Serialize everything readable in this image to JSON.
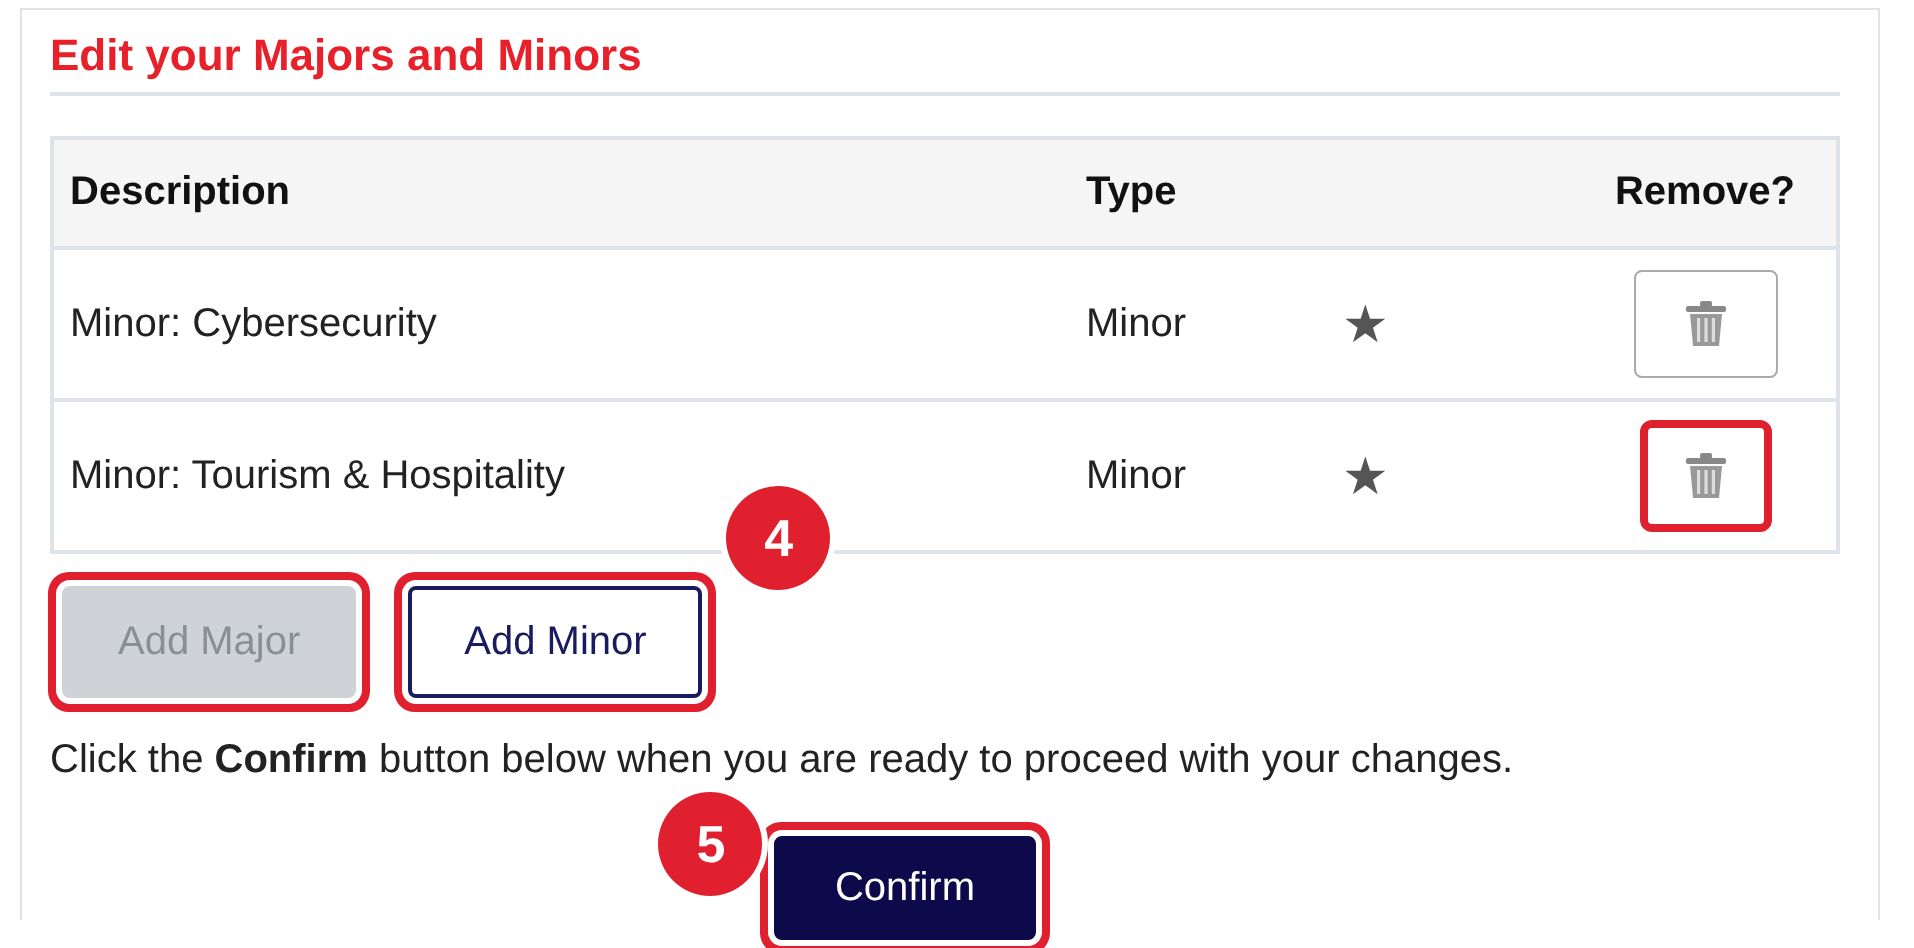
{
  "heading": "Edit your Majors and Minors",
  "table": {
    "columns": [
      "Description",
      "Type",
      "Remove?"
    ],
    "rows": [
      {
        "description": "Minor: Cybersecurity",
        "type": "Minor",
        "star": "★",
        "remove_highlighted": false
      },
      {
        "description": "Minor: Tourism & Hospitality",
        "type": "Minor",
        "star": "★",
        "remove_highlighted": true
      }
    ]
  },
  "add_buttons": [
    {
      "label": "Add Major",
      "disabled": true,
      "highlighted": true
    },
    {
      "label": "Add Minor",
      "disabled": false,
      "highlighted": true,
      "callout": "4"
    }
  ],
  "instruction": "Click the **Confirm** button below when you are ready to proceed with your changes.",
  "confirm": {
    "label": "Confirm",
    "highlighted": true,
    "callout": "5"
  }
}
